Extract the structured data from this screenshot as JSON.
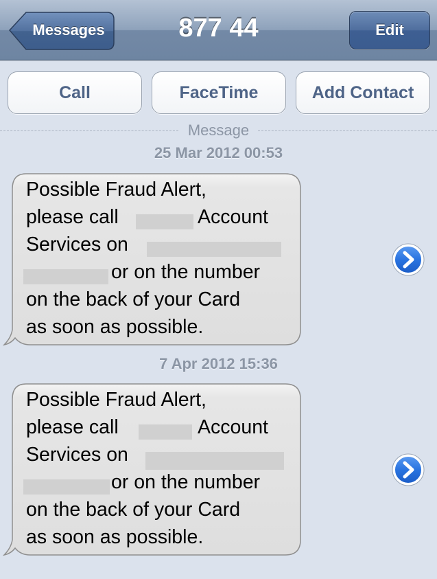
{
  "navbar": {
    "back_label": "Messages",
    "title": "877 44",
    "edit_label": "Edit"
  },
  "actions": {
    "call_label": "Call",
    "facetime_label": "FaceTime",
    "add_contact_label": "Add Contact"
  },
  "conversation": {
    "divider_label": "Message",
    "messages": [
      {
        "timestamp": "25 Mar 2012 00:53",
        "lines": [
          "Possible Fraud Alert,",
          "please call",
          "Account",
          "Services on",
          "or on the number",
          "on the back of your Card",
          "as soon as possible."
        ]
      },
      {
        "timestamp": "7 Apr 2012 15:36",
        "lines": [
          "Possible Fraud Alert,",
          "please call",
          "Account",
          "Services on",
          "or on the number",
          "on the back of your Card",
          "as soon as possible."
        ]
      }
    ]
  },
  "colors": {
    "background": "#dbe2ed",
    "bubble": "#e5e5e5",
    "accent_blue": "#1f6fe0",
    "button_text": "#4e6487"
  },
  "icons": {
    "detail": "chevron-right-circle-icon"
  }
}
